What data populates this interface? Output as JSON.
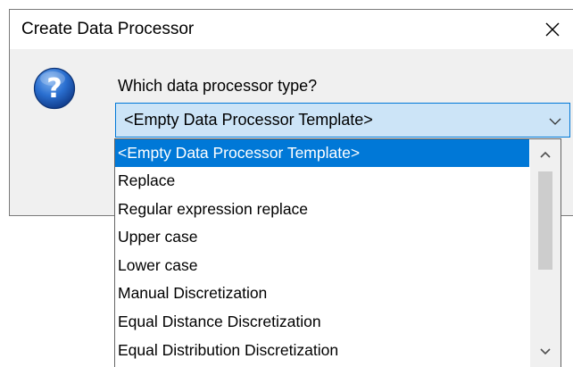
{
  "window": {
    "title": "Create Data Processor",
    "close_icon": "close-icon"
  },
  "main": {
    "icon": "question-icon",
    "prompt": "Which data processor type?",
    "combo": {
      "selected_value": "<Empty Data Processor Template>",
      "arrow_icon": "chevron-down-icon"
    }
  },
  "dropdown": {
    "items": [
      {
        "label": "<Empty Data Processor Template>",
        "selected": true
      },
      {
        "label": "Replace",
        "selected": false
      },
      {
        "label": "Regular expression replace",
        "selected": false
      },
      {
        "label": "Upper case",
        "selected": false
      },
      {
        "label": "Lower case",
        "selected": false
      },
      {
        "label": "Manual Discretization",
        "selected": false
      },
      {
        "label": "Equal Distance Discretization",
        "selected": false
      },
      {
        "label": "Equal Distribution Discretization",
        "selected": false
      }
    ],
    "scrollbar": {
      "up_icon": "chevron-up-icon",
      "down_icon": "chevron-down-icon",
      "position": 0
    }
  },
  "colors": {
    "selection": "#0078d7",
    "combo_background": "#cce4f7",
    "dialog_background": "#f0f0f0",
    "question_icon_blue": "#1f5fb8"
  }
}
